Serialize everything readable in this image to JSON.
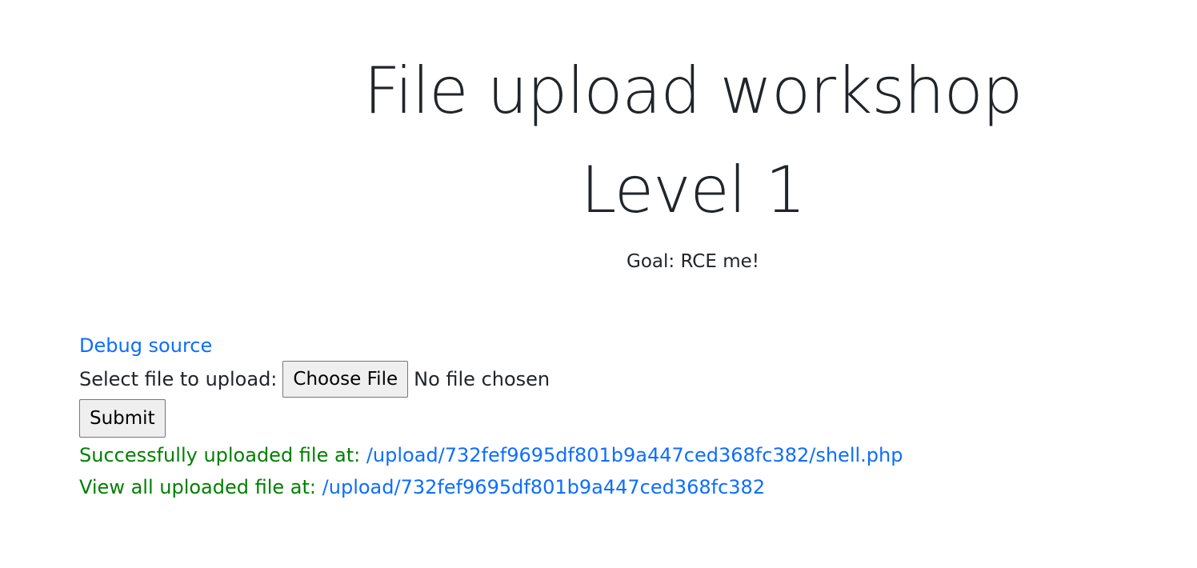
{
  "header": {
    "title_line1": "File upload workshop",
    "title_line2": "Level 1",
    "goal": "Goal: RCE me!"
  },
  "links": {
    "debug_source": "Debug source"
  },
  "form": {
    "select_label": "Select file to upload:",
    "choose_file_label": "Choose File",
    "file_status": "No file chosen",
    "submit_label": "Submit"
  },
  "messages": {
    "success_prefix": "Successfully uploaded file at:",
    "success_path": "/upload/732fef9695df801b9a447ced368fc382/shell.php",
    "view_prefix": "View all uploaded file at:",
    "view_path": "/upload/732fef9695df801b9a447ced368fc382"
  },
  "colors": {
    "link": "#0d6efd",
    "success": "#008000",
    "text": "#212529"
  }
}
